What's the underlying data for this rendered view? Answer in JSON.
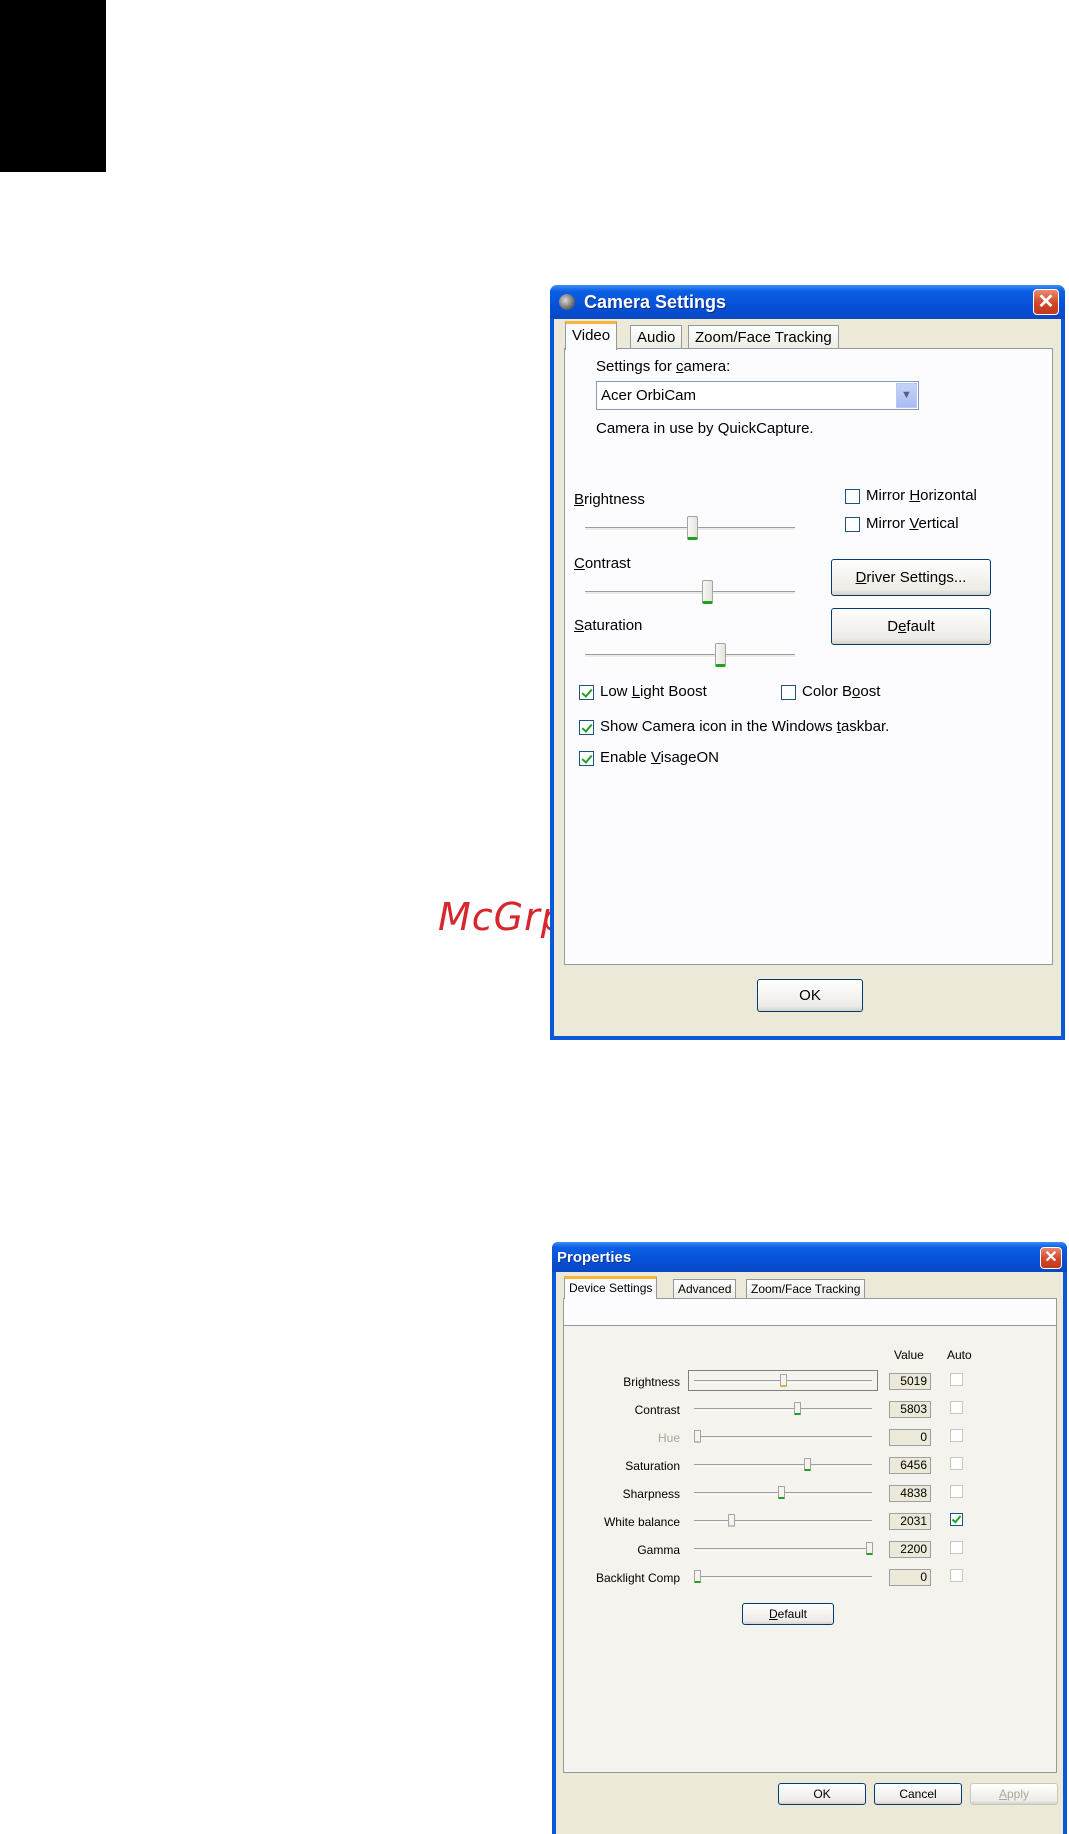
{
  "watermark": "McGrp.Ru",
  "camera_settings": {
    "title": "Camera Settings",
    "tabs": [
      "Video",
      "Audio",
      "Zoom/Face Tracking"
    ],
    "settings_for_camera_label": "Settings for camera:",
    "camera_select_value": "Acer OrbiCam",
    "camera_status": "Camera in use by QuickCapture.",
    "sliders": [
      {
        "label": "Brightness",
        "value_fraction": 0.5
      },
      {
        "label": "Contrast",
        "value_fraction": 0.58
      },
      {
        "label": "Saturation",
        "value_fraction": 0.64
      }
    ],
    "mirror_horizontal": {
      "label": "Mirror Horizontal",
      "checked": false
    },
    "mirror_vertical": {
      "label": "Mirror Vertical",
      "checked": false
    },
    "driver_settings_button": "Driver Settings...",
    "default_button": "Default",
    "low_light_boost": {
      "label": "Low Light Boost",
      "checked": true
    },
    "color_boost": {
      "label": "Color Boost",
      "checked": false
    },
    "show_camera_icon": {
      "label": "Show Camera icon in the Windows taskbar.",
      "checked": true
    },
    "enable_visageon": {
      "label": "Enable VisageON",
      "checked": true
    },
    "ok_button": "OK"
  },
  "properties": {
    "title": "Properties",
    "tabs": [
      "Device Settings",
      "Advanced",
      "Zoom/Face Tracking"
    ],
    "value_header": "Value",
    "auto_header": "Auto",
    "rows": [
      {
        "label": "Brightness",
        "value": "5019",
        "fraction": 0.5,
        "auto": false,
        "disabled": false
      },
      {
        "label": "Contrast",
        "value": "5803",
        "fraction": 0.58,
        "auto": false,
        "disabled": false
      },
      {
        "label": "Hue",
        "value": "0",
        "fraction": 0.0,
        "auto": false,
        "disabled": true
      },
      {
        "label": "Saturation",
        "value": "6456",
        "fraction": 0.64,
        "auto": false,
        "disabled": false
      },
      {
        "label": "Sharpness",
        "value": "4838",
        "fraction": 0.48,
        "auto": false,
        "disabled": false
      },
      {
        "label": "White balance",
        "value": "2031",
        "fraction": 0.2,
        "auto": true,
        "disabled": false
      },
      {
        "label": "Gamma",
        "value": "2200",
        "fraction": 1.0,
        "auto": false,
        "disabled": false
      },
      {
        "label": "Backlight Comp",
        "value": "0",
        "fraction": 0.0,
        "auto": false,
        "disabled": false
      }
    ],
    "default_button": "Default",
    "ok_button": "OK",
    "cancel_button": "Cancel",
    "apply_button": "Apply"
  }
}
